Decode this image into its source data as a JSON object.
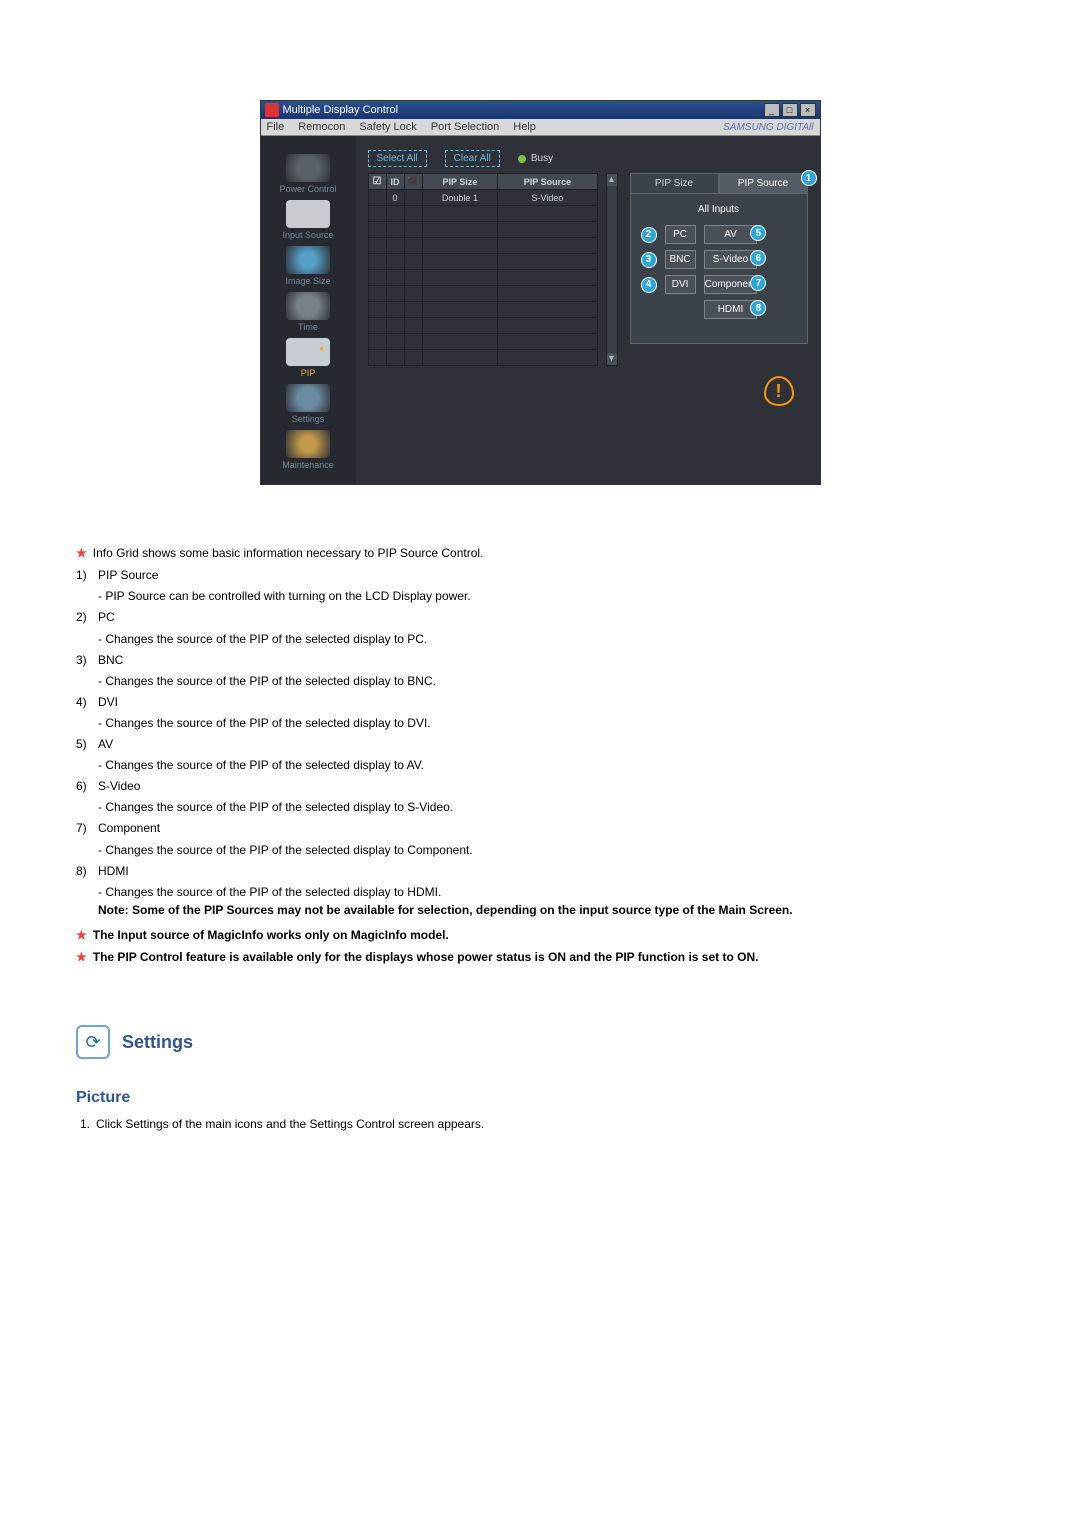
{
  "window": {
    "title": "Multiple Display Control",
    "win_min": "_",
    "win_max": "□",
    "win_close": "×"
  },
  "menu": {
    "file": "File",
    "remocon": "Remocon",
    "safety": "Safety Lock",
    "port": "Port Selection",
    "help": "Help",
    "brand": "SAMSUNG DIGITAll"
  },
  "sidebar": {
    "power": "Power Control",
    "input": "Input Source",
    "image": "Image Size",
    "time": "Time",
    "pip": "PIP",
    "settings": "Settings",
    "maint": "Maintenance"
  },
  "toolbar": {
    "select_all": "Select All",
    "clear_all": "Clear All",
    "busy": "Busy"
  },
  "grid": {
    "col_size": "PIP Size",
    "col_src": "PIP Source",
    "row": {
      "id": "0",
      "size": "Double 1",
      "src": "S-Video"
    }
  },
  "detail": {
    "tab_size": "PIP Size",
    "tab_src": "PIP Source",
    "panel_title": "All Inputs",
    "opts": {
      "pc": "PC",
      "bnc": "BNC",
      "dvi": "DVI",
      "av": "AV",
      "svideo": "S-Video",
      "component": "Component",
      "hdmi": "HDMI"
    },
    "callouts": {
      "c1": "1",
      "c2": "2",
      "c3": "3",
      "c4": "4",
      "c5": "5",
      "c6": "6",
      "c7": "7",
      "c8": "8"
    }
  },
  "doc": {
    "star_intro": "Info Grid shows some basic information necessary to PIP Source Control.",
    "items": {
      "i1_t": "PIP Source",
      "i1_d": "- PIP Source can be controlled with turning on the LCD Display power.",
      "i2_t": "PC",
      "i2_d": "- Changes the source of the PIP of the selected display to PC.",
      "i3_t": "BNC",
      "i3_d": "- Changes the source of the PIP of the selected display to BNC.",
      "i4_t": "DVI",
      "i4_d": "- Changes the source of the PIP of the selected display to DVI.",
      "i5_t": "AV",
      "i5_d": "- Changes the source of the PIP of the selected display to AV.",
      "i6_t": "S-Video",
      "i6_d": "- Changes the source of the PIP of the selected display to S-Video.",
      "i7_t": "Component",
      "i7_d": "- Changes the source of the PIP of the selected display to Component.",
      "i8_t": "HDMI",
      "i8_d": "- Changes the source of the PIP of the selected display to HDMI."
    },
    "note": "Note: Some of the PIP Sources may not be available for selection, depending on the input source type of the Main Screen.",
    "star_b1": "The Input source of MagicInfo works only on MagicInfo model.",
    "star_b2": "The PIP Control feature is available only for the displays whose power status is ON and the PIP function is set to ON.",
    "settings_heading": "Settings",
    "picture_heading": "Picture",
    "picture_step_num": "1.",
    "picture_step": "Click Settings of the main icons and the Settings Control screen appears."
  },
  "nums": {
    "n1": "1)",
    "n2": "2)",
    "n3": "3)",
    "n4": "4)",
    "n5": "5)",
    "n6": "6)",
    "n7": "7)",
    "n8": "8)"
  }
}
